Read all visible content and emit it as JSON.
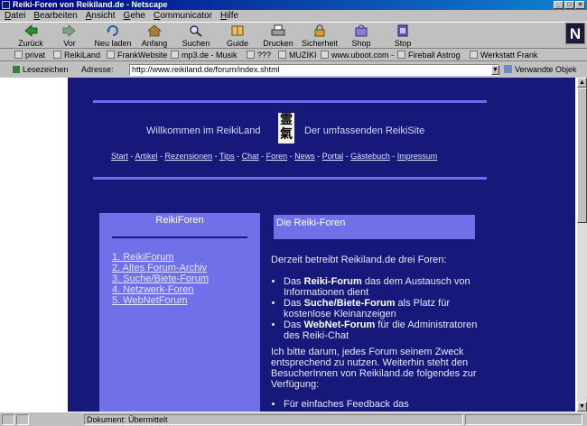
{
  "window": {
    "title": "Reiki-Foren von Reikiland.de - Netscape"
  },
  "menu": [
    "Datei",
    "Bearbeiten",
    "Ansicht",
    "Gehe",
    "Communicator",
    "Hilfe"
  ],
  "toolbar": [
    {
      "label": "Zurück",
      "icon": "back-arrow-icon"
    },
    {
      "label": "Vor",
      "icon": "forward-arrow-icon"
    },
    {
      "label": "Neu laden",
      "icon": "reload-icon"
    },
    {
      "label": "Anfang",
      "icon": "home-icon"
    },
    {
      "label": "Suchen",
      "icon": "search-icon"
    },
    {
      "label": "Guide",
      "icon": "guide-icon"
    },
    {
      "label": "Drucken",
      "icon": "print-icon"
    },
    {
      "label": "Sicherheit",
      "icon": "security-icon"
    },
    {
      "label": "Shop",
      "icon": "shop-icon"
    },
    {
      "label": "Stop",
      "icon": "stop-icon"
    }
  ],
  "personal_toolbar": [
    "privat",
    "ReikiLand",
    "FrankWebsite",
    "mp3.de - Musik",
    "???",
    "MUZIKI",
    "www.uboot.com -",
    "Fireball Astrog",
    "Werkstatt Frank"
  ],
  "location": {
    "bookmarks_label": "Lesezeichen",
    "address_label": "Adresse:",
    "url": "http://www.reikiland.de/forum/index.shtml",
    "related_label": "Verwandte Objek"
  },
  "page": {
    "welcome_left": "Willkommen im ReikiLand",
    "welcome_right": "Der umfassenden ReikiSite",
    "kanji": "霊氣",
    "nav": [
      "Start",
      "Artikel",
      "Rezensionen",
      "Tips",
      "Chat",
      "Foren",
      "News",
      "Portal",
      "Gästebuch",
      "Impressum"
    ],
    "nav_sep": " - ",
    "left_heading": "ReikiForen",
    "forums": [
      "1. ReikiForum",
      "2. Altes Forum-Archiv",
      "3. Suche/Biete-Forum",
      "4. Netzwerk-Foren",
      "5. WebNetForum"
    ],
    "right_heading": "Die Reiki-Foren",
    "intro": "Derzeit betreibt Reikiland.de drei Foren:",
    "items": [
      {
        "pre": "Das ",
        "bold": "Reiki-Forum",
        "post": " das dem Austausch von Informationen dient"
      },
      {
        "pre": "Das ",
        "bold": "Suche/Biete-Forum",
        "post": " als Platz für kostenlose Kleinanzeigen"
      },
      {
        "pre": "Das ",
        "bold": "WebNet-Forum",
        "post": " für die Administratoren des Reiki-Chat"
      }
    ],
    "para2": "Ich bitte darum, jedes Forum seinem Zweck entsprechend zu nutzen. Weiterhin steht den BesucherInnen von Reikiland.de folgendes zur Verfügung:",
    "item_last": "Für einfaches Feedback das"
  },
  "status": {
    "text": "Dokument: Übermittelt"
  },
  "colors": {
    "page_bg": "#17197a",
    "column_bg": "#7070e8",
    "rule": "#6c6cf0"
  }
}
